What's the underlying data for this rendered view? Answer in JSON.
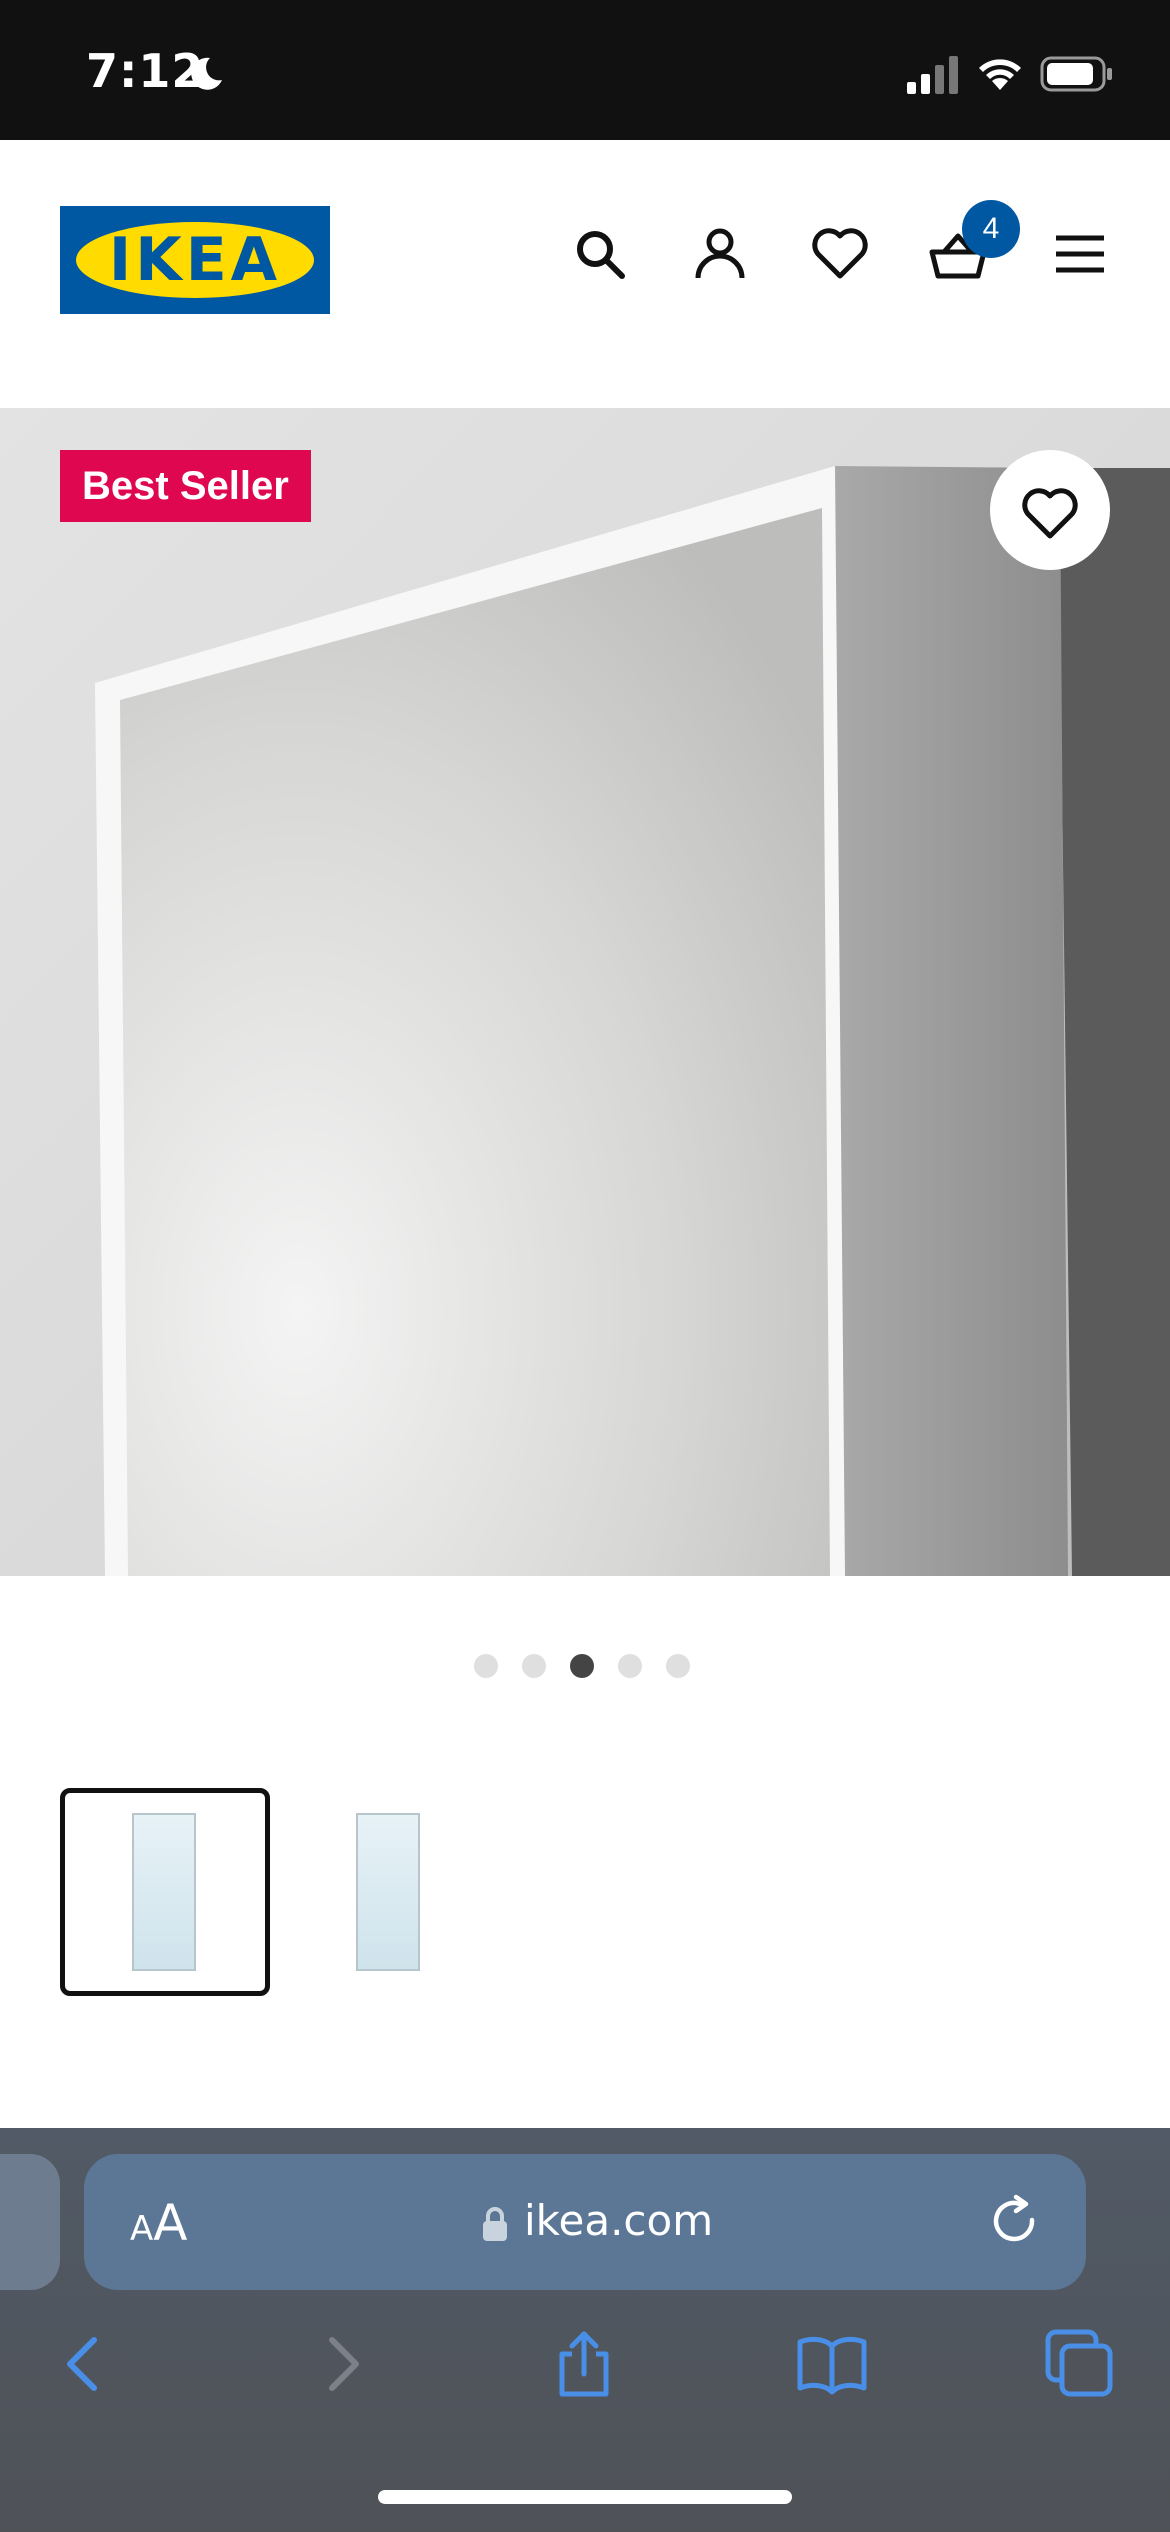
{
  "status_bar": {
    "time": "7:12",
    "icons": [
      "moon-icon",
      "cellular-signal-icon",
      "wifi-icon",
      "battery-icon"
    ]
  },
  "header": {
    "logo_text": "IKEA",
    "icons": [
      "search-icon",
      "account-icon",
      "heart-icon",
      "basket-icon",
      "menu-icon"
    ],
    "cart_count": "4"
  },
  "hero": {
    "badge": "Best Seller",
    "favorite_icon": "heart-icon",
    "image": "white framed mirror"
  },
  "carousel": {
    "dot_count": 5,
    "active_index": 2
  },
  "thumbnails": [
    {
      "selected": true,
      "image": "mirror thumbnail"
    },
    {
      "selected": false,
      "image": "mirror thumbnail"
    }
  ],
  "browser": {
    "text_size_label": "AA",
    "url": "ikea.com",
    "toolbar_icons": [
      "back-icon",
      "forward-icon",
      "share-icon",
      "bookmarks-icon",
      "tabs-icon"
    ]
  },
  "colors": {
    "brand_blue": "#0058a3",
    "brand_yellow": "#ffdb00",
    "badge_red": "#e00751",
    "safari_accent": "#4a8fe7"
  }
}
